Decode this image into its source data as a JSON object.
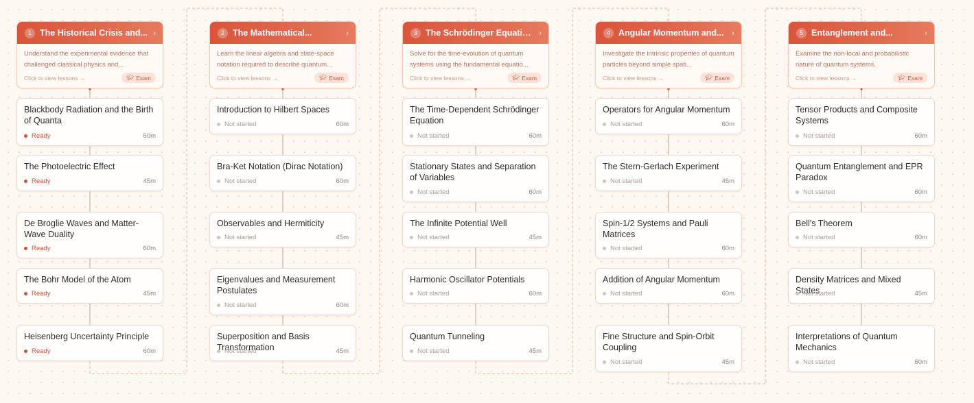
{
  "modules": [
    {
      "number": "1",
      "title": "The Historical Crisis and...",
      "description": "Understand the experimental evidence that challenged classical physics and...",
      "view_lessons": "Click to view lessons →",
      "exam_label": "Exam",
      "lessons": [
        {
          "title": "Blackbody Radiation and the Birth of Quanta",
          "status": "Ready",
          "duration": "60m"
        },
        {
          "title": "The Photoelectric Effect",
          "status": "Ready",
          "duration": "45m"
        },
        {
          "title": "De Broglie Waves and Matter-Wave Duality",
          "status": "Ready",
          "duration": "60m"
        },
        {
          "title": "The Bohr Model of the Atom",
          "status": "Ready",
          "duration": "45m"
        },
        {
          "title": "Heisenberg Uncertainty Principle",
          "status": "Ready",
          "duration": "60m"
        }
      ]
    },
    {
      "number": "2",
      "title": "The Mathematical...",
      "description": "Learn the linear algebra and state-space notation required to describe quantum...",
      "view_lessons": "Click to view lessons →",
      "exam_label": "Exam",
      "lessons": [
        {
          "title": "Introduction to Hilbert Spaces",
          "status": "Not started",
          "duration": "60m"
        },
        {
          "title": "Bra-Ket Notation (Dirac Notation)",
          "status": "Not started",
          "duration": "60m"
        },
        {
          "title": "Observables and Hermiticity",
          "status": "Not started",
          "duration": "45m"
        },
        {
          "title": "Eigenvalues and Measurement Postulates",
          "status": "Not started",
          "duration": "60m"
        },
        {
          "title": "Superposition and Basis Transformation",
          "status": "Not started",
          "duration": "45m"
        }
      ]
    },
    {
      "number": "3",
      "title": "The Schrödinger Equatio...",
      "description": "Solve for the time-evolution of quantum systems using the fundamental equatio...",
      "view_lessons": "Click to view lessons →",
      "exam_label": "Exam",
      "lessons": [
        {
          "title": "The Time-Dependent Schrödinger Equation",
          "status": "Not started",
          "duration": "60m"
        },
        {
          "title": "Stationary States and Separation of Variables",
          "status": "Not started",
          "duration": "60m"
        },
        {
          "title": "The Infinite Potential Well",
          "status": "Not started",
          "duration": "45m"
        },
        {
          "title": "Harmonic Oscillator Potentials",
          "status": "Not started",
          "duration": "60m"
        },
        {
          "title": "Quantum Tunneling",
          "status": "Not started",
          "duration": "45m"
        }
      ]
    },
    {
      "number": "4",
      "title": "Angular Momentum and...",
      "description": "Investigate the intrinsic properties of quantum particles beyond simple spati...",
      "view_lessons": "Click to view lessons →",
      "exam_label": "Exam",
      "lessons": [
        {
          "title": "Operators for Angular Momentum",
          "status": "Not started",
          "duration": "60m"
        },
        {
          "title": "The Stern-Gerlach Experiment",
          "status": "Not started",
          "duration": "45m"
        },
        {
          "title": "Spin-1/2 Systems and Pauli Matrices",
          "status": "Not started",
          "duration": "60m"
        },
        {
          "title": "Addition of Angular Momentum",
          "status": "Not started",
          "duration": "60m"
        },
        {
          "title": "Fine Structure and Spin-Orbit Coupling",
          "status": "Not started",
          "duration": "45m"
        }
      ]
    },
    {
      "number": "5",
      "title": "Entanglement and...",
      "description": "Examine the non-local and probabilistic nature of quantum systems.",
      "view_lessons": "Click to view lessons →",
      "exam_label": "Exam",
      "lessons": [
        {
          "title": "Tensor Products and Composite Systems",
          "status": "Not started",
          "duration": "60m"
        },
        {
          "title": "Quantum Entanglement and EPR Paradox",
          "status": "Not started",
          "duration": "60m"
        },
        {
          "title": "Bell's Theorem",
          "status": "Not started",
          "duration": "60m"
        },
        {
          "title": "Density Matrices and Mixed States",
          "status": "Not started",
          "duration": "45m"
        },
        {
          "title": "Interpretations of Quantum Mechanics",
          "status": "Not started",
          "duration": "60m"
        }
      ]
    }
  ],
  "colors": {
    "accent": "#d9553b",
    "ready": "#d2503a",
    "not_started": "#cfc3b9",
    "background": "#fdf8f2"
  },
  "icons": {
    "header_chevron": "chevron-right-icon",
    "exam": "graduation-cap-icon",
    "status": "status-dot-icon"
  }
}
